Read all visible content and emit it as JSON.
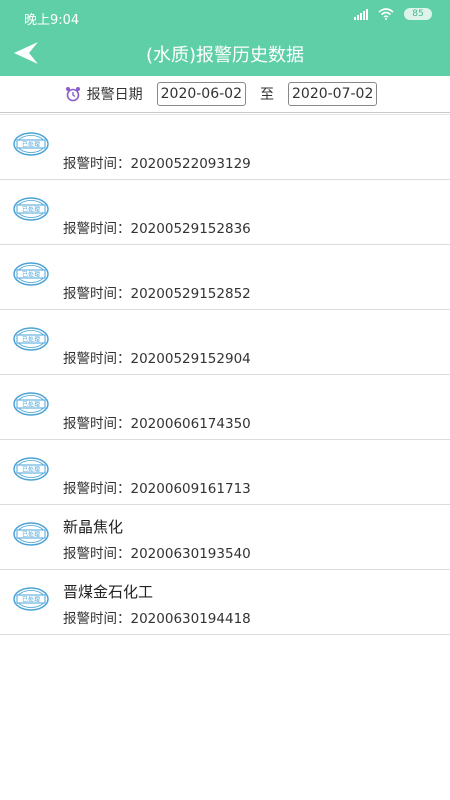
{
  "status": {
    "time": "晚上9:04",
    "battery": "85"
  },
  "header": {
    "title": "(水质)报警历史数据"
  },
  "filter": {
    "label": "报警日期",
    "start_date": "2020-06-02",
    "separator": "至",
    "end_date": "2020-07-02"
  },
  "stamp_text": "已处理",
  "time_label": "报警时间：",
  "records": [
    {
      "name": "",
      "time": "20200522093129"
    },
    {
      "name": "",
      "time": "20200529152836"
    },
    {
      "name": "",
      "time": "20200529152852"
    },
    {
      "name": "",
      "time": "20200529152904"
    },
    {
      "name": "",
      "time": "20200606174350"
    },
    {
      "name": "",
      "time": "20200609161713"
    },
    {
      "name": "新晶焦化",
      "time": "20200630193540"
    },
    {
      "name": "晋煤金石化工",
      "time": "20200630194418"
    }
  ],
  "colors": {
    "header": "#5fcfa8",
    "stamp": "#4aa3d8"
  }
}
